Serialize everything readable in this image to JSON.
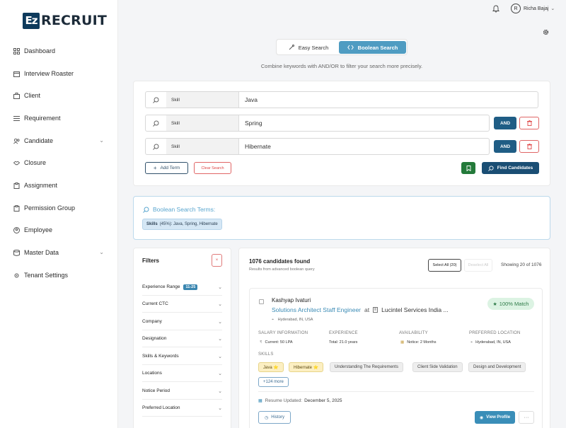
{
  "brand": {
    "logo_mark": "Ez",
    "logo_text": "RECRUIT",
    "color": "#0e3a5c"
  },
  "sidebar": {
    "items": [
      {
        "label": "Dashboard",
        "icon": "grid-icon"
      },
      {
        "label": "Interview Roaster",
        "icon": "calendar-icon"
      },
      {
        "label": "Client",
        "icon": "briefcase-icon"
      },
      {
        "label": "Requirement",
        "icon": "list-icon"
      },
      {
        "label": "Candidate",
        "icon": "users-icon"
      },
      {
        "label": "Closure",
        "icon": "handshake-icon"
      },
      {
        "label": "Assignment",
        "icon": "clipboard-icon"
      },
      {
        "label": "Permission Group",
        "icon": "clipboard-icon"
      },
      {
        "label": "Employee",
        "icon": "user-circle-icon"
      },
      {
        "label": "Master Data",
        "icon": "database-icon"
      },
      {
        "label": "Tenant Settings",
        "icon": "cog-icon"
      }
    ]
  },
  "topbar": {
    "avatar_initial": "R",
    "user_name": "Richa Bajaj",
    "chevron": "⌄"
  },
  "search_toggle": {
    "easy_label": "Easy Search",
    "boolean_label": "Boolean Search",
    "active": "boolean",
    "hint": "Combine keywords with AND/OR to filter your search more precisely."
  },
  "query": {
    "rows": [
      {
        "field": "Skill",
        "value": "Java"
      },
      {
        "field": "Skill",
        "value": "Spring",
        "operator": "AND"
      },
      {
        "field": "Skill",
        "value": "Hibernate",
        "operator": "AND"
      }
    ],
    "add_term": "Add Term",
    "clear_search": "Clear Search",
    "find_candidates": "Find Candidates"
  },
  "boolean_terms": {
    "title": "Boolean Search Terms:",
    "chip_label": "Skills",
    "chip_detail": "(45%): Java, Spring, Hibernate"
  },
  "filters": {
    "title": "Filters",
    "close": "×",
    "items": [
      {
        "label": "Experience Range",
        "badge": "11-25"
      },
      {
        "label": "Current CTC"
      },
      {
        "label": "Company"
      },
      {
        "label": "Designation"
      },
      {
        "label": "Skills & Keywords"
      },
      {
        "label": "Locations"
      },
      {
        "label": "Notice Period"
      },
      {
        "label": "Preferred Location"
      }
    ]
  },
  "results": {
    "count": "1076 candidates found",
    "subtitle": "Results from advanced boolean query",
    "select_all": "Select All (20)",
    "deselect_all": "Deselect All",
    "showing": "Showing 20 of 1076"
  },
  "candidate": {
    "name": "Kashyap Ivaturi",
    "role": "Solutions Architect Staff Engineer",
    "at": "at",
    "company": "Lucintel Services India ...",
    "location": "Hyderabad, IN, USA",
    "match": "100% Match",
    "salary_label": "SALARY INFORMATION",
    "salary_value": "Current: 50 LPA",
    "experience_label": "EXPERIENCE",
    "experience_value": "Total: 21.0 years",
    "availability_label": "AVAILABILITY",
    "availability_value": "Notice: 2 Months",
    "preferred_label": "PREFERRED LOCATION",
    "preferred_value": "Hyderabad, IN, USA",
    "skills_label": "SKILLS",
    "skills": [
      "Java ⭐",
      "Hibernate ⭐",
      "Understanding The Requirements",
      "Client Side Validation",
      "Design and Development"
    ],
    "more_skills": "+124 more",
    "resume_label": "Resume Updated:",
    "resume_date": "December 5, 2025",
    "history": "History",
    "view_profile": "View Profile",
    "more": "···"
  }
}
